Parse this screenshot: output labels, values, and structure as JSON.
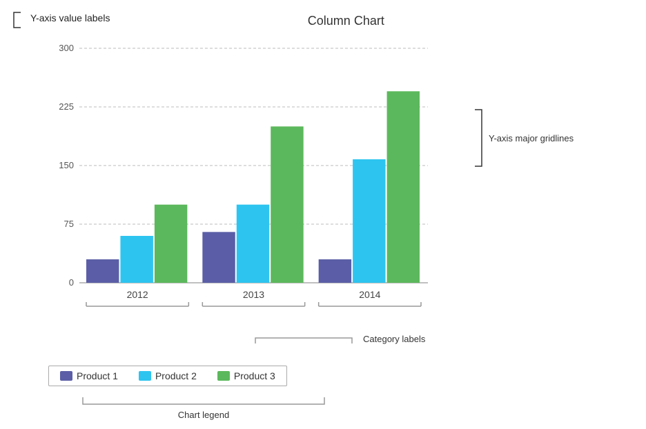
{
  "chart": {
    "title": "Column Chart",
    "yAxis": {
      "labels": [
        "0",
        "75",
        "150",
        "225",
        "300"
      ],
      "values": [
        0,
        75,
        150,
        225,
        300
      ],
      "max": 300
    },
    "categories": [
      "2012",
      "2013",
      "2014"
    ],
    "series": [
      {
        "name": "Product 1",
        "color": "#5b5ea6",
        "data": [
          30,
          65,
          30
        ]
      },
      {
        "name": "Product 2",
        "color": "#2ec4f0",
        "data": [
          60,
          100,
          158
        ]
      },
      {
        "name": "Product 3",
        "color": "#5cb85c",
        "data": [
          100,
          200,
          245
        ]
      }
    ]
  },
  "annotations": {
    "yAxisLabel": "Y-axis value labels",
    "yAxisGridlines": "Y-axis major gridlines",
    "categoryLabels": "Category labels",
    "chartLegend": "Chart legend"
  },
  "legend": {
    "items": [
      {
        "label": "Product 1",
        "color": "#5b5ea6"
      },
      {
        "label": "Product 2",
        "color": "#2ec4f0"
      },
      {
        "label": "Product 3",
        "color": "#5cb85c"
      }
    ]
  }
}
